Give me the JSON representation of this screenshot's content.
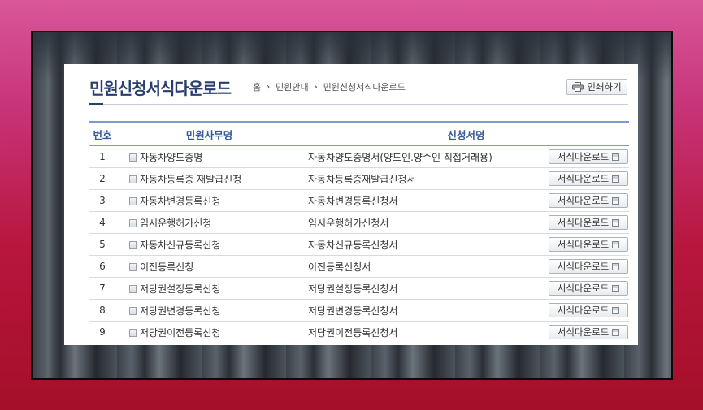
{
  "page": {
    "title": "민원신청서식다운로드",
    "breadcrumb": [
      "홈",
      "민원안내",
      "민원신청서식다운로드"
    ],
    "print_label": "인쇄하기"
  },
  "table": {
    "columns": [
      "번호",
      "민원사무명",
      "신청서명"
    ],
    "download_label": "서식다운로드",
    "rows": [
      {
        "no": "1",
        "name": "자동차양도증명",
        "form": "자동차양도증명서(양도인.양수인 직접거래용)"
      },
      {
        "no": "2",
        "name": "자동차등록증 재발급신청",
        "form": "자동차등록증재발급신청서"
      },
      {
        "no": "3",
        "name": "자동차변경등록신청",
        "form": "자동차변경등록신청서"
      },
      {
        "no": "4",
        "name": "임시운행허가신청",
        "form": "임시운행허가신청서"
      },
      {
        "no": "5",
        "name": "자동차신규등록신청",
        "form": "자동차신규등록신청서"
      },
      {
        "no": "6",
        "name": "이전등록신청",
        "form": "이전등록신청서"
      },
      {
        "no": "7",
        "name": "저당권설정등록신청",
        "form": "저당권설정등록신청서"
      },
      {
        "no": "8",
        "name": "저당권변경등록신청",
        "form": "저당권변경등록신청서"
      },
      {
        "no": "9",
        "name": "저당권이전등록신청",
        "form": "저당권이전등록신청서"
      }
    ]
  },
  "icons": {
    "print": "printer-icon",
    "document": "document-icon",
    "download": "disk-icon",
    "separator": "chevron-right-icon"
  }
}
